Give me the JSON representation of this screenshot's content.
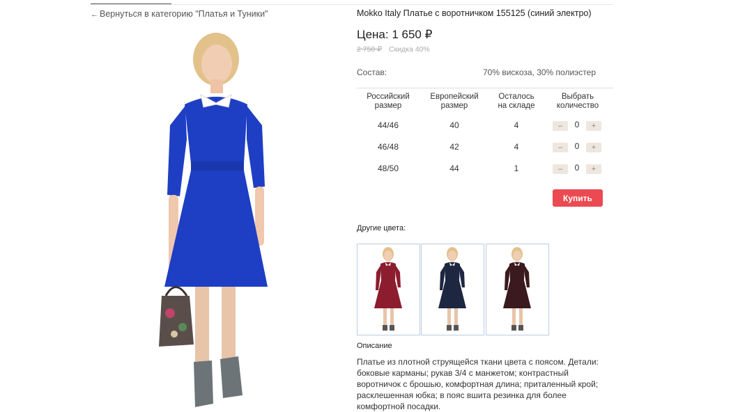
{
  "back_link": {
    "arrow": "←",
    "label": "Вернуться в категорию \"Платья и Туники\""
  },
  "product": {
    "title": "Mokko Italy Платье с воротничком 155125 (синий электро)",
    "price_label": "Цена: 1 650 ₽",
    "old_price": "2 750 ₽",
    "discount": "Скидка 40%",
    "composition_label": "Состав:",
    "composition_value": "70% вискоза, 30% полиэстер"
  },
  "sizes": {
    "headers": [
      "Российский\nразмер",
      "Европейский\nразмер",
      "Осталось\nна складе",
      "Выбрать\nколичество"
    ],
    "rows": [
      {
        "ru": "44/46",
        "eu": "40",
        "stock": "4",
        "qty": "0"
      },
      {
        "ru": "46/48",
        "eu": "42",
        "stock": "4",
        "qty": "0"
      },
      {
        "ru": "48/50",
        "eu": "44",
        "stock": "1",
        "qty": "0"
      }
    ],
    "minus": "–",
    "plus": "+"
  },
  "buy_button": "Купить",
  "other_colors": {
    "label": "Другие цвета:",
    "colors": [
      "#8c1d2e",
      "#1d2742",
      "#3a1a1e"
    ]
  },
  "main_color": "#1e3fc4",
  "description": {
    "label": "Описание",
    "text": "Платье из плотной  струящейся ткани  цвета с поясом. Детали: боковые карманы; рукав 3/4 с манжетом; контрастный воротничок с брошью, комфортная длина; приталенный крой; расклешенная юбка; в пояс вшита резинка для более комфортной посадки."
  }
}
